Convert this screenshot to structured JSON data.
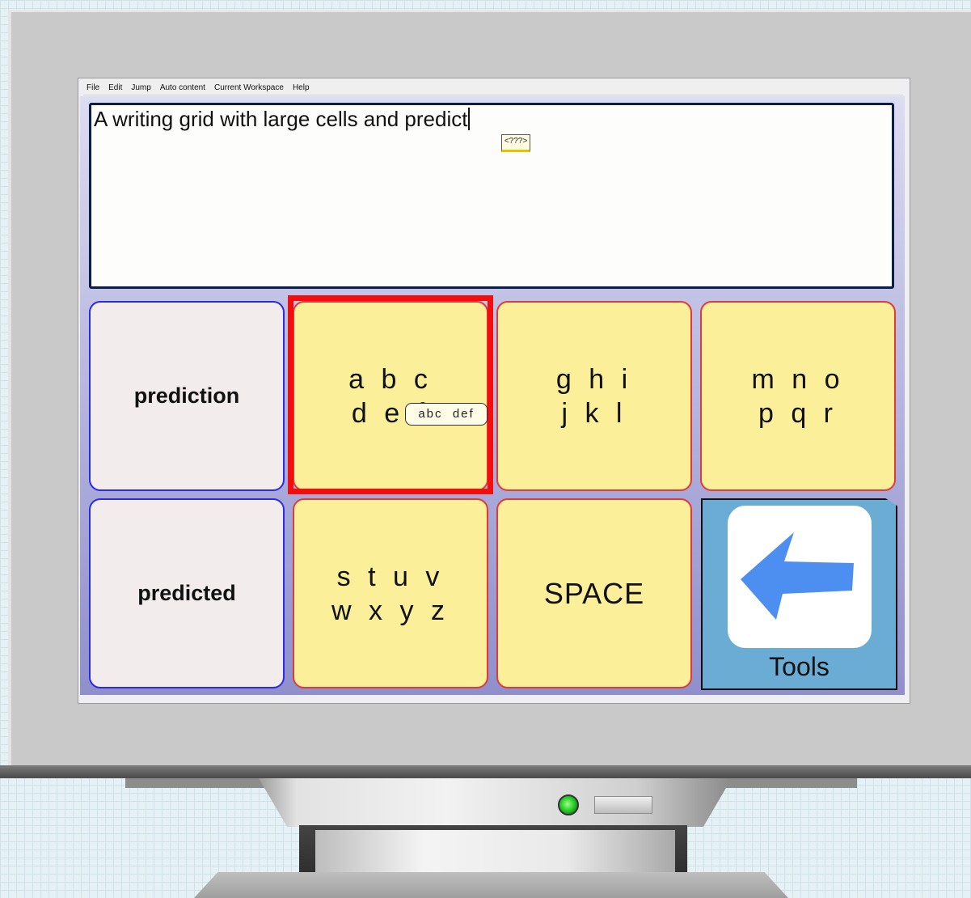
{
  "menu": [
    "File",
    "Edit",
    "Jump",
    "Auto content",
    "Current Workspace",
    "Help"
  ],
  "editor": {
    "text": "A writing grid with large cells and predict",
    "unknown_word_tag": "<???>"
  },
  "grid": {
    "prediction_label": "prediction",
    "predicted_label": "predicted",
    "abc_letters": "a b c\nd e f",
    "ghi_letters": "g h i\nj k l",
    "mno_letters": "m n o\np q r",
    "stuv_letters": "s t u v\nw x y z",
    "space_label": "SPACE",
    "tools_label": "Tools",
    "tools_icon": "left-arrow-icon",
    "tooltip": "abc  def"
  },
  "colors": {
    "letter_cell": "#fbef99",
    "prediction_cell": "#f2ecec",
    "selection": "#f40d0d",
    "tools_cell": "#6aacd3",
    "arrow": "#4d8ff0"
  }
}
